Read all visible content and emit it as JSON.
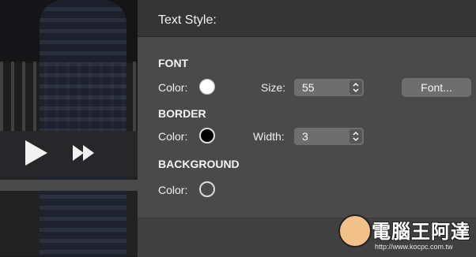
{
  "panel": {
    "title": "Text Style:"
  },
  "font": {
    "heading": "FONT",
    "color_label": "Color:",
    "size_label": "Size:",
    "size_value": "55",
    "font_button_label": "Font...",
    "swatch_color": "#ffffff"
  },
  "border": {
    "heading": "BORDER",
    "color_label": "Color:",
    "width_label": "Width:",
    "width_value": "3",
    "swatch_color": "#000000"
  },
  "background": {
    "heading": "BACKGROUND",
    "color_label": "Color:",
    "swatch_color": "transparent"
  },
  "player": {
    "progress": 1.0
  },
  "watermark": {
    "text": "電腦王阿達",
    "url": "http://www.kocpc.com.tw"
  },
  "icons": [
    "play-icon",
    "fast-forward-icon",
    "stepper-arrows-icon"
  ]
}
